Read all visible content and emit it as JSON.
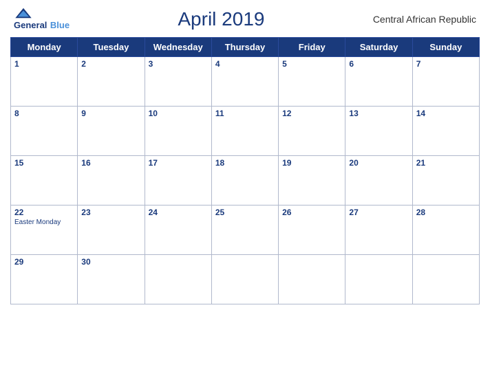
{
  "header": {
    "logo_line1": "General",
    "logo_line2": "Blue",
    "title": "April 2019",
    "country": "Central African Republic"
  },
  "calendar": {
    "weekdays": [
      "Monday",
      "Tuesday",
      "Wednesday",
      "Thursday",
      "Friday",
      "Saturday",
      "Sunday"
    ],
    "weeks": [
      [
        {
          "day": "1",
          "events": []
        },
        {
          "day": "2",
          "events": []
        },
        {
          "day": "3",
          "events": []
        },
        {
          "day": "4",
          "events": []
        },
        {
          "day": "5",
          "events": []
        },
        {
          "day": "6",
          "events": []
        },
        {
          "day": "7",
          "events": []
        }
      ],
      [
        {
          "day": "8",
          "events": []
        },
        {
          "day": "9",
          "events": []
        },
        {
          "day": "10",
          "events": []
        },
        {
          "day": "11",
          "events": []
        },
        {
          "day": "12",
          "events": []
        },
        {
          "day": "13",
          "events": []
        },
        {
          "day": "14",
          "events": []
        }
      ],
      [
        {
          "day": "15",
          "events": []
        },
        {
          "day": "16",
          "events": []
        },
        {
          "day": "17",
          "events": []
        },
        {
          "day": "18",
          "events": []
        },
        {
          "day": "19",
          "events": []
        },
        {
          "day": "20",
          "events": []
        },
        {
          "day": "21",
          "events": []
        }
      ],
      [
        {
          "day": "22",
          "events": [
            "Easter Monday"
          ]
        },
        {
          "day": "23",
          "events": []
        },
        {
          "day": "24",
          "events": []
        },
        {
          "day": "25",
          "events": []
        },
        {
          "day": "26",
          "events": []
        },
        {
          "day": "27",
          "events": []
        },
        {
          "day": "28",
          "events": []
        }
      ],
      [
        {
          "day": "29",
          "events": []
        },
        {
          "day": "30",
          "events": []
        },
        {
          "day": "",
          "events": []
        },
        {
          "day": "",
          "events": []
        },
        {
          "day": "",
          "events": []
        },
        {
          "day": "",
          "events": []
        },
        {
          "day": "",
          "events": []
        }
      ]
    ]
  }
}
